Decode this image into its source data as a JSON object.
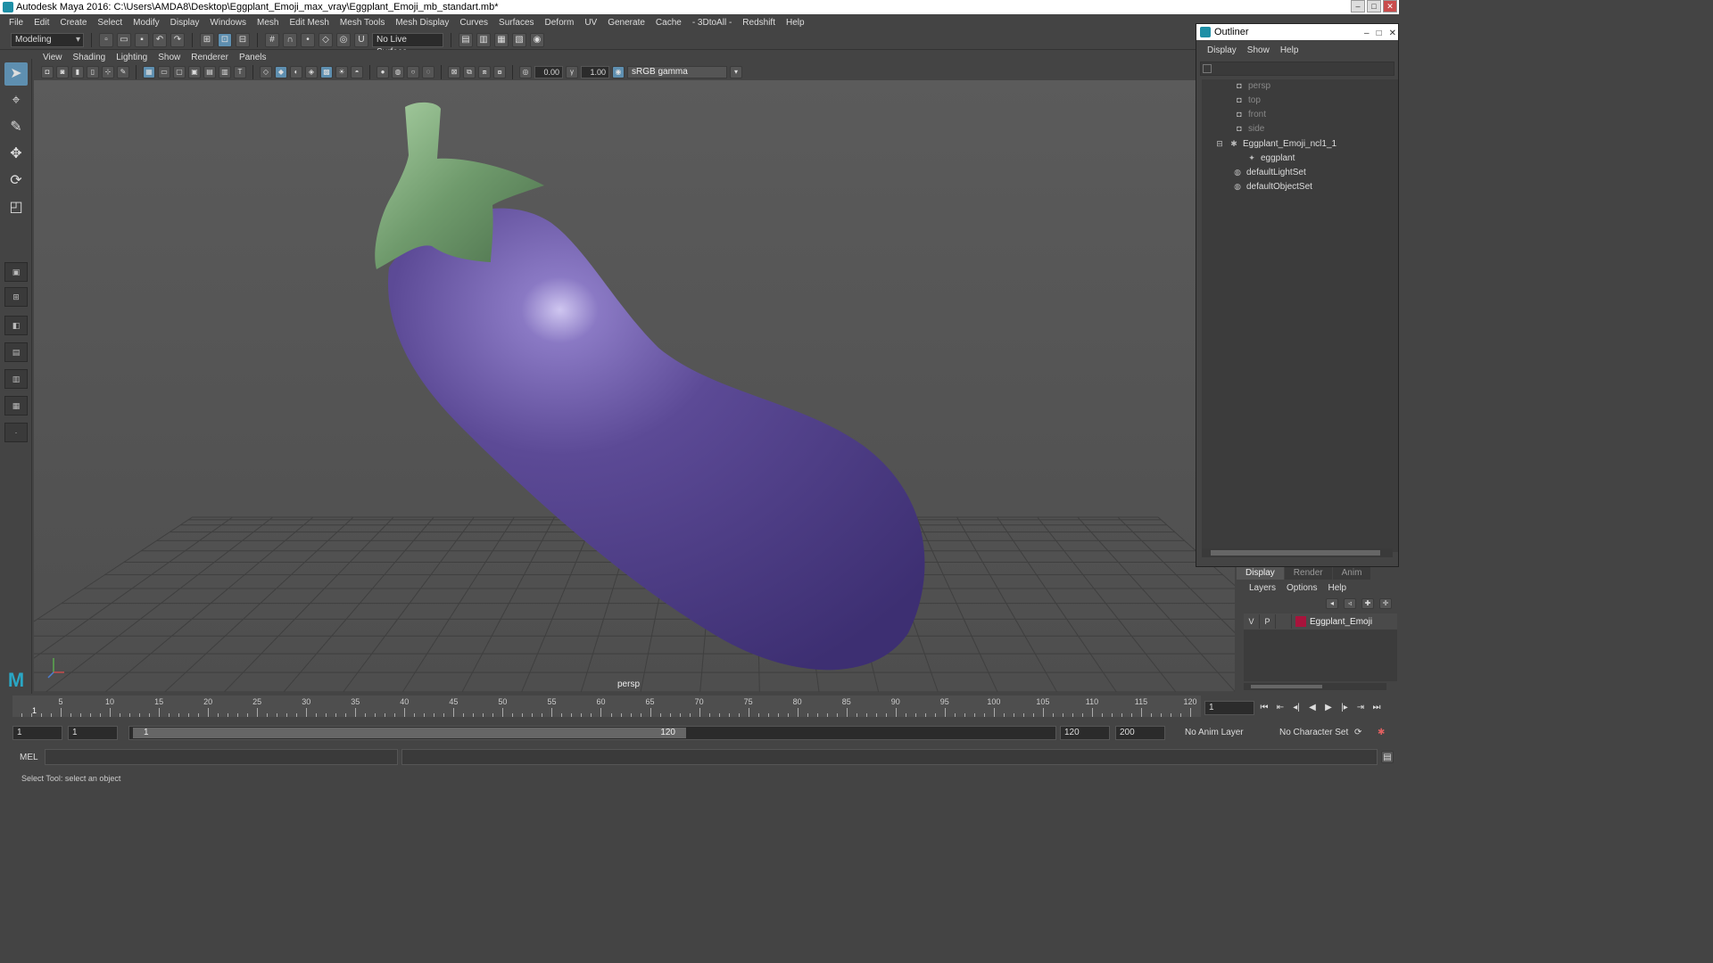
{
  "window": {
    "title": "Autodesk Maya 2016: C:\\Users\\AMDA8\\Desktop\\Eggplant_Emoji_max_vray\\Eggplant_Emoji_mb_standart.mb*"
  },
  "menubar": [
    "File",
    "Edit",
    "Create",
    "Select",
    "Modify",
    "Display",
    "Windows",
    "Mesh",
    "Edit Mesh",
    "Mesh Tools",
    "Mesh Display",
    "Curves",
    "Surfaces",
    "Deform",
    "UV",
    "Generate",
    "Cache",
    "- 3DtoAll -",
    "Redshift",
    "Help"
  ],
  "statusline": {
    "mode": "Modeling",
    "live_surface": "No Live Surface"
  },
  "panel": {
    "menu": [
      "View",
      "Shading",
      "Lighting",
      "Show",
      "Renderer",
      "Panels"
    ],
    "exposure": "0.00",
    "gamma": "1.00",
    "color_space": "sRGB gamma",
    "camera_label": "persp"
  },
  "outliner": {
    "title": "Outliner",
    "menu": [
      "Display",
      "Show",
      "Help"
    ],
    "items": [
      {
        "label": "persp"
      },
      {
        "label": "top"
      },
      {
        "label": "front"
      },
      {
        "label": "side"
      },
      {
        "label": "Eggplant_Emoji_ncl1_1"
      },
      {
        "label": "eggplant"
      },
      {
        "label": "defaultLightSet"
      },
      {
        "label": "defaultObjectSet"
      }
    ]
  },
  "layer_editor": {
    "tabs": [
      "Display",
      "Render",
      "Anim"
    ],
    "menu": [
      "Layers",
      "Options",
      "Help"
    ],
    "layer": {
      "v": "V",
      "p": "P",
      "name": "Eggplant_Emoji",
      "color": "#a8143c"
    }
  },
  "timeslider": {
    "ticks": [
      "5",
      "10",
      "15",
      "20",
      "25",
      "30",
      "35",
      "40",
      "45",
      "50",
      "55",
      "60",
      "65",
      "70",
      "75",
      "80",
      "85",
      "90",
      "95",
      "100",
      "105",
      "110",
      "115",
      "120"
    ],
    "current_frame": "1",
    "current_field": "1"
  },
  "range": {
    "start": "1",
    "playback_start": "1",
    "slider_start": "1",
    "slider_end": "120",
    "playback_end": "120",
    "end": "200",
    "anim_layer": "No Anim Layer",
    "character_set": "No Character Set"
  },
  "command": {
    "label": "MEL"
  },
  "helpline": "Select Tool: select an object",
  "colors": {
    "accent": "#5e8fb0",
    "eggplant": "#5c4a96",
    "stem": "#6f9a6c"
  }
}
